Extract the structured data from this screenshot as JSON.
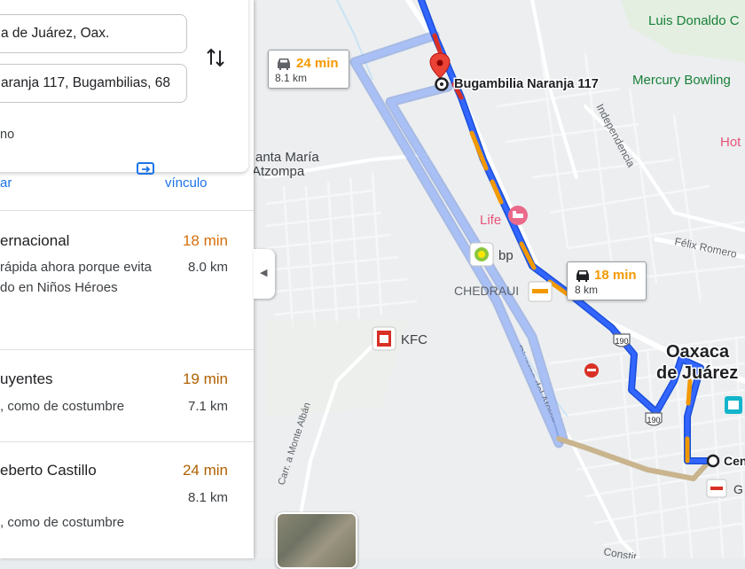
{
  "directions": {
    "origin_value": "a de Juárez, Oax.",
    "destination_value": "aranja 117, Bugambilias, 68",
    "swap_icon": "swap-vertical-icon",
    "leave_now": "no",
    "actions": {
      "left_label": "ar",
      "share_label": "vínculo",
      "share_icon": "send-to-phone-icon"
    }
  },
  "routes": [
    {
      "name": "ernacional",
      "time": "18 min",
      "time_color": "#d56e0c",
      "distance": "8.0 km",
      "desc_lines": [
        "rápida ahora porque evita",
        "do en Niños Héroes"
      ]
    },
    {
      "name": "uyentes",
      "time": "19 min",
      "time_color": "#b06000",
      "distance": "7.1 km",
      "desc_lines": [
        ", como de costumbre"
      ]
    },
    {
      "name": "eberto Castillo",
      "time": "24 min",
      "time_color": "#b06000",
      "distance": "8.1 km",
      "desc_lines": [
        ", como de costumbre"
      ]
    }
  ],
  "map": {
    "callouts": [
      {
        "time": "24 min",
        "distance": "8.1 km",
        "time_color": "#f29900",
        "icon": "car-icon"
      },
      {
        "time": "18 min",
        "distance": "8 km",
        "time_color": "#f29900",
        "icon": "car-icon"
      }
    ],
    "destination_label": "Bugambilia Naranja 117",
    "places": {
      "luis_donaldo": "Luis Donaldo C",
      "mercury": "Mercury Bowling",
      "hotel": "Hot",
      "santa_maria_1": "anta María",
      "santa_maria_2": "Atzompa",
      "life": "Life",
      "bp": "bp",
      "chedraui": "CHEDRAUI",
      "kfc": "KFC",
      "oaxaca_1": "Oaxaca",
      "oaxaca_2": "de Juárez",
      "origin_label": "Cen",
      "g_label": "G",
      "felix_romero": "Félix Romero",
      "independencia": "Independencia",
      "riveras": "Riveras del Atoyac",
      "monte_alban": "Carr. a Monte Albán",
      "constit": "Constit",
      "shield_190a": "190",
      "shield_190b": "190"
    },
    "colors": {
      "route_fast": "#1a5cff",
      "route_alt": "#a7bdf5",
      "traffic_orange": "#f29900",
      "traffic_red": "#d93025",
      "origin_segment": "#c9b48e"
    }
  }
}
